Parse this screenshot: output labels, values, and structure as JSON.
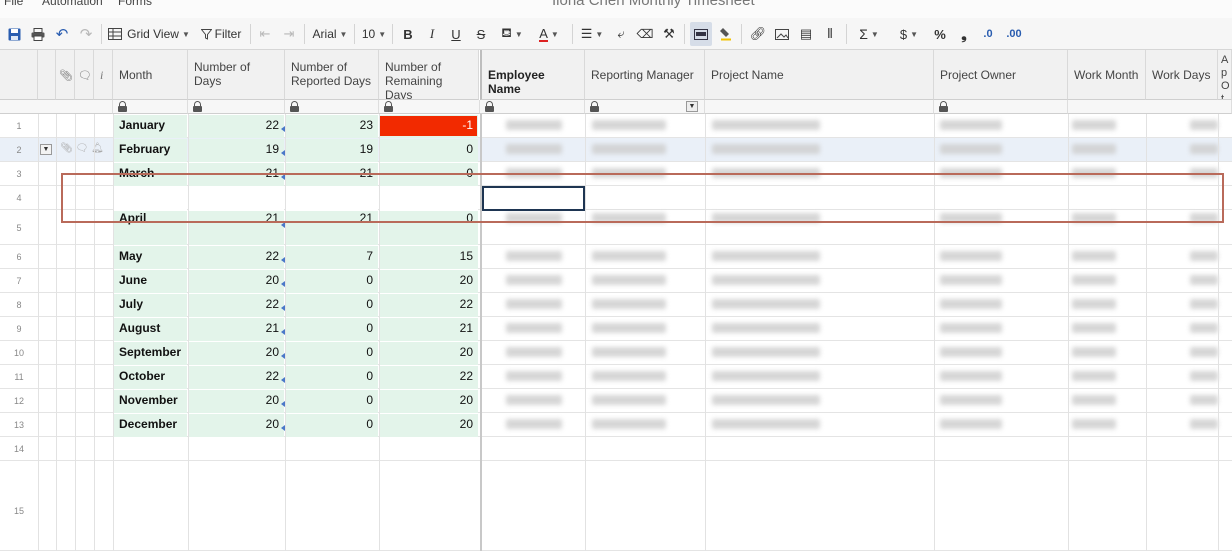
{
  "app": {
    "menu": [
      "File",
      "Automation",
      "Forms"
    ],
    "title": "Ilona Chen Monthly Timesheet"
  },
  "toolbar": {
    "view_label": "Grid View",
    "filter_label": "Filter",
    "font_family": "Arial",
    "font_size": "10",
    "bold": "B",
    "italic": "I",
    "underline": "U",
    "strike": "S",
    "text_color": "A",
    "sum": "Σ",
    "currency": "$",
    "percent": "%",
    "comma": "❟",
    "decrease_decimal": ".0",
    "increase_decimal": ".00"
  },
  "columns": {
    "month": "Month",
    "number_of_days": "Number of Days",
    "reported_days": "Number of Reported Days",
    "remaining_days": "Number of Remaining Days",
    "employee_name": "Employee Name",
    "reporting_manager": "Reporting Manager",
    "project_name": "Project Name",
    "project_owner": "Project Owner",
    "work_month": "Work Month",
    "work_days": "Work Days",
    "approval": "Ap Ot Bu"
  },
  "rows": [
    {
      "n": "1",
      "month": "January",
      "days": "22",
      "reported": "23",
      "remaining": "-1"
    },
    {
      "n": "2",
      "month": "February",
      "days": "19",
      "reported": "19",
      "remaining": "0"
    },
    {
      "n": "3",
      "month": "March",
      "days": "21",
      "reported": "21",
      "remaining": "0"
    },
    {
      "n": "4",
      "month": "",
      "days": "",
      "reported": "",
      "remaining": ""
    },
    {
      "n": "5",
      "month": "April",
      "days": "21",
      "reported": "21",
      "remaining": "0"
    },
    {
      "n": "6",
      "month": "May",
      "days": "22",
      "reported": "7",
      "remaining": "15"
    },
    {
      "n": "7",
      "month": "June",
      "days": "20",
      "reported": "0",
      "remaining": "20"
    },
    {
      "n": "8",
      "month": "July",
      "days": "22",
      "reported": "0",
      "remaining": "22"
    },
    {
      "n": "9",
      "month": "August",
      "days": "21",
      "reported": "0",
      "remaining": "21"
    },
    {
      "n": "10",
      "month": "September",
      "days": "20",
      "reported": "0",
      "remaining": "20"
    },
    {
      "n": "11",
      "month": "October",
      "days": "22",
      "reported": "0",
      "remaining": "22"
    },
    {
      "n": "12",
      "month": "November",
      "days": "20",
      "reported": "0",
      "remaining": "20"
    },
    {
      "n": "13",
      "month": "December",
      "days": "20",
      "reported": "0",
      "remaining": "20"
    },
    {
      "n": "14",
      "month": "",
      "days": "",
      "reported": "",
      "remaining": ""
    },
    {
      "n": "15",
      "month": "",
      "days": "",
      "reported": "",
      "remaining": ""
    }
  ],
  "colors": {
    "negative_cell": "#f22a00",
    "formula_fill": "#e3f4ea",
    "highlight_box": "#b96a5a",
    "selection": "#1e3552"
  }
}
